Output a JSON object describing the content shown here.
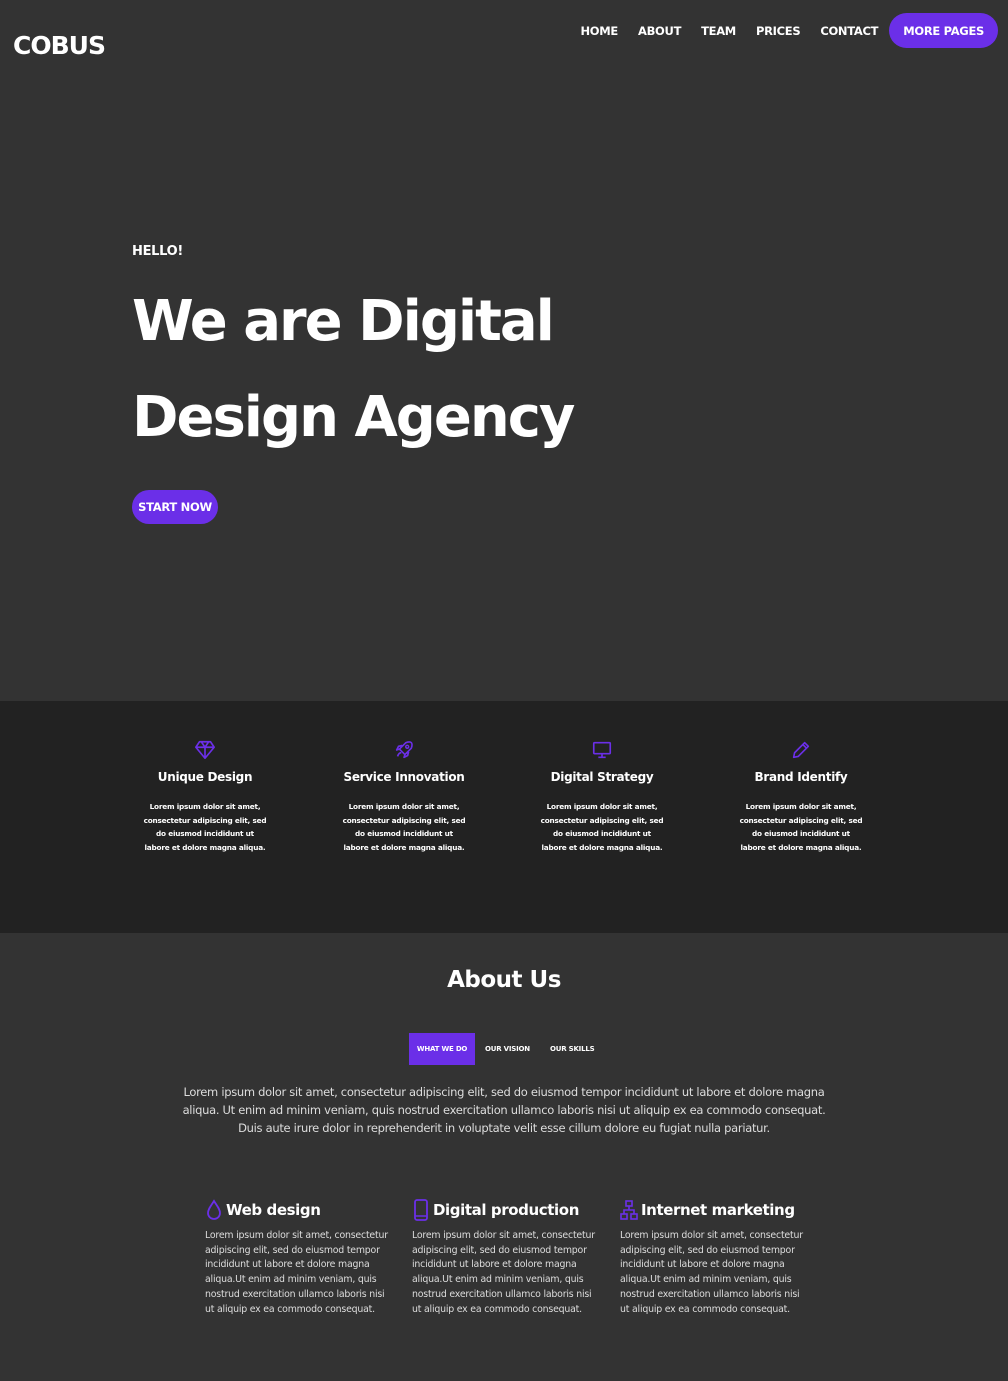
{
  "header": {
    "logo": "COBUS",
    "nav": [
      "HOME",
      "ABOUT",
      "TEAM",
      "PRICES",
      "CONTACT"
    ],
    "more_pages": "MORE PAGES"
  },
  "hero": {
    "hello": "HELLO!",
    "headline": "We are Digital Design Agency",
    "cta": "START NOW"
  },
  "features": [
    {
      "icon": "diamond-icon",
      "title": "Unique Design",
      "text": "Lorem ipsum dolor sit amet, consectetur adipiscing elit, sed do eiusmod incididunt ut labore et dolore magna aliqua."
    },
    {
      "icon": "rocket-icon",
      "title": "Service Innovation",
      "text": "Lorem ipsum dolor sit amet, consectetur adipiscing elit, sed do eiusmod incididunt ut labore et dolore magna aliqua."
    },
    {
      "icon": "monitor-icon",
      "title": "Digital Strategy",
      "text": "Lorem ipsum dolor sit amet, consectetur adipiscing elit, sed do eiusmod incididunt ut labore et dolore magna aliqua."
    },
    {
      "icon": "pencil-icon",
      "title": "Brand Identify",
      "text": "Lorem ipsum dolor sit amet, consectetur adipiscing elit, sed do eiusmod incididunt ut labore et dolore magna aliqua."
    }
  ],
  "about": {
    "title": "About Us",
    "tabs": [
      "WHAT WE DO",
      "OUR VISION",
      "OUR SKILLS"
    ],
    "active_tab": "WHAT WE DO",
    "text": "Lorem ipsum dolor sit amet, consectetur adipiscing elit, sed do eiusmod tempor incididunt ut labore et dolore magna aliqua. Ut enim ad minim veniam, quis nostrud exercitation ullamco laboris nisi ut aliquip ex ea commodo consequat. Duis aute irure dolor in reprehenderit in voluptate velit esse cillum dolore eu fugiat nulla pariatur."
  },
  "services": [
    {
      "icon": "drop-icon",
      "title": "Web design",
      "text": "Lorem ipsum dolor sit amet, consectetur adipiscing elit, sed do eiusmod tempor incididunt ut labore et dolore magna aliqua.Ut enim ad minim veniam, quis nostrud exercitation ullamco laboris nisi ut aliquip ex ea commodo consequat."
    },
    {
      "icon": "mobile-icon",
      "title": "Digital production",
      "text": "Lorem ipsum dolor sit amet, consectetur adipiscing elit, sed do eiusmod tempor incididunt ut labore et dolore magna aliqua.Ut enim ad minim veniam, quis nostrud exercitation ullamco laboris nisi ut aliquip ex ea commodo consequat."
    },
    {
      "icon": "sitemap-icon",
      "title": "Internet marketing",
      "text": "Lorem ipsum dolor sit amet, consectetur adipiscing elit, sed do eiusmod tempor incididunt ut labore et dolore magna aliqua.Ut enim ad minim veniam, quis nostrud exercitation ullamco laboris nisi ut aliquip ex ea commodo consequat."
    }
  ],
  "colors": {
    "accent": "#6b2fe8",
    "background": "#333333",
    "band": "#222222"
  }
}
